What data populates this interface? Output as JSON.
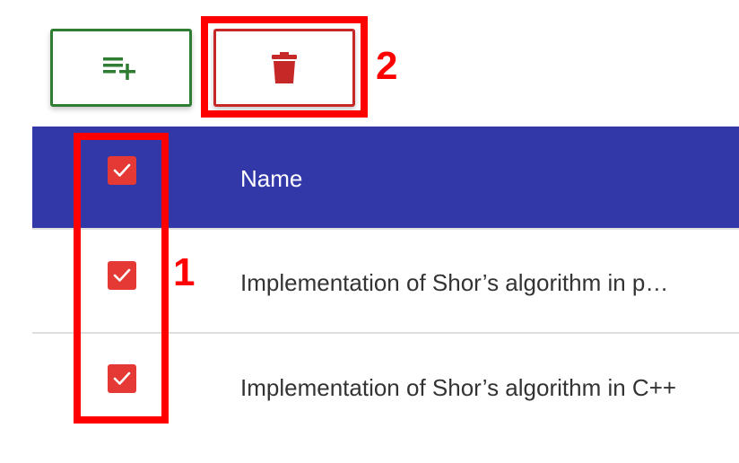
{
  "toolbar": {
    "add_icon": "playlist-add-icon",
    "delete_icon": "trash-icon",
    "add_color": "#2e7d32",
    "delete_color": "#c62828"
  },
  "annotations": {
    "callout_2": "2",
    "callout_1": "1",
    "highlight_color": "#ff0000"
  },
  "table": {
    "header_color": "#3338a8",
    "columns": [
      "Name"
    ],
    "header_checked": true,
    "rows": [
      {
        "name": "Implementation of Shor’s algorithm in p…",
        "checked": true
      },
      {
        "name": "Implementation of Shor’s algorithm in C++",
        "checked": true
      }
    ]
  },
  "checkbox_color": "#e53935"
}
